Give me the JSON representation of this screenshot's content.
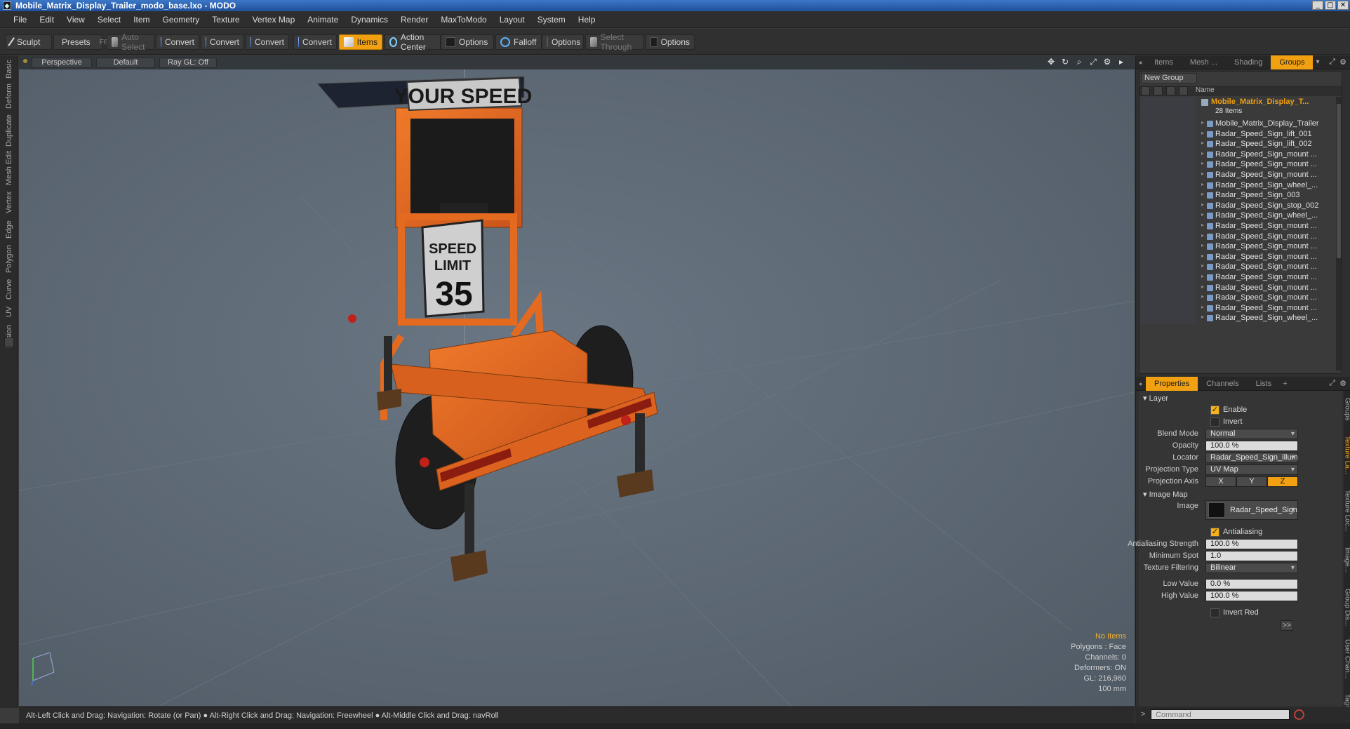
{
  "window": {
    "title": "Mobile_Matrix_Display_Trailer_modo_base.lxo - MODO",
    "controls": [
      "_",
      "▢",
      "✕"
    ]
  },
  "menu": [
    "File",
    "Edit",
    "View",
    "Select",
    "Item",
    "Geometry",
    "Texture",
    "Vertex Map",
    "Animate",
    "Dynamics",
    "Render",
    "MaxToModo",
    "Layout",
    "System",
    "Help"
  ],
  "toolbar": {
    "sculpt": "Sculpt",
    "presets": "Presets",
    "presets_key": "F6",
    "auto_select": "Auto Select",
    "convert": "Convert",
    "items": "Items",
    "action_center": "Action Center",
    "options": "Options",
    "falloff": "Falloff",
    "select_through": "Select Through"
  },
  "left_tabs": [
    "Basic",
    "Deform",
    "Duplicate",
    "Mesh Edit",
    "Vertex",
    "Edge",
    "Polygon",
    "Curve",
    "UV",
    "Fusion"
  ],
  "viewport": {
    "view": "Perspective",
    "shading": "Default",
    "raygl": "Ray GL: Off",
    "stats": {
      "selection": "No Items",
      "polygons": "Polygons : Face",
      "channels": "Channels: 0",
      "deformers": "Deformers: ON",
      "gl": "GL: 216,960",
      "scale": "100 mm"
    },
    "sign_top": "YOUR SPEED",
    "sign_speed": "SPEED",
    "sign_limit": "LIMIT",
    "sign_number": "35"
  },
  "status": "Alt-Left Click and Drag: Navigation: Rotate (or Pan) ● Alt-Right Click and Drag: Navigation: Freewheel ● Alt-Middle Click and Drag: navRoll",
  "groups_panel": {
    "tabs": [
      "Items",
      "Mesh ...",
      "Shading",
      "Groups"
    ],
    "new_group": "New Group",
    "name_header": "Name",
    "group_name": "Mobile_Matrix_Display_T...",
    "group_count": "28 Items",
    "items": [
      "Mobile_Matrix_Display_Trailer",
      "Radar_Speed_Sign_lift_001",
      "Radar_Speed_Sign_lift_002",
      "Radar_Speed_Sign_mount ...",
      "Radar_Speed_Sign_mount ...",
      "Radar_Speed_Sign_mount ...",
      "Radar_Speed_Sign_wheel_...",
      "Radar_Speed_Sign_003",
      "Radar_Speed_Sign_stop_002",
      "Radar_Speed_Sign_wheel_...",
      "Radar_Speed_Sign_mount ...",
      "Radar_Speed_Sign_mount ...",
      "Radar_Speed_Sign_mount ...",
      "Radar_Speed_Sign_mount ...",
      "Radar_Speed_Sign_mount ...",
      "Radar_Speed_Sign_mount ...",
      "Radar_Speed_Sign_mount ...",
      "Radar_Speed_Sign_mount ...",
      "Radar_Speed_Sign_mount ...",
      "Radar_Speed_Sign_wheel_..."
    ]
  },
  "properties_panel": {
    "tabs": [
      "Properties",
      "Channels",
      "Lists",
      "+"
    ],
    "layer_section": "Layer",
    "enable": "Enable",
    "invert": "Invert",
    "blend_mode_label": "Blend Mode",
    "blend_mode": "Normal",
    "opacity_label": "Opacity",
    "opacity": "100.0 %",
    "locator_label": "Locator",
    "locator": "Radar_Speed_Sign_illum_chil...",
    "projection_type_label": "Projection Type",
    "projection_type": "UV Map",
    "projection_axis_label": "Projection Axis",
    "axis_x": "X",
    "axis_y": "Y",
    "axis_z": "Z",
    "image_map_section": "Image Map",
    "image_label": "Image",
    "image": "Radar_Speed_Sign_...",
    "antialiasing": "Antialiasing",
    "aa_strength_label": "Antialiasing Strength",
    "aa_strength": "100.0 %",
    "min_spot_label": "Minimum Spot",
    "min_spot": "1.0",
    "tex_filter_label": "Texture Filtering",
    "tex_filter": "Bilinear",
    "low_value_label": "Low Value",
    "low_value": "0.0 %",
    "high_value_label": "High Value",
    "high_value": "100.0 %",
    "invert_red": "Invert Red",
    "more": ">>"
  },
  "right_vtabs": [
    "Groups",
    "Texture La...",
    "Texture Loc...",
    "Image...",
    "Group Dis...",
    "User Chan...",
    "Tags"
  ],
  "command": {
    "prompt": ">",
    "placeholder": "Command"
  },
  "colors": {
    "accent": "#f0a010",
    "trailer_orange": "#e8661a",
    "viewport_bg": "#5b6672"
  }
}
